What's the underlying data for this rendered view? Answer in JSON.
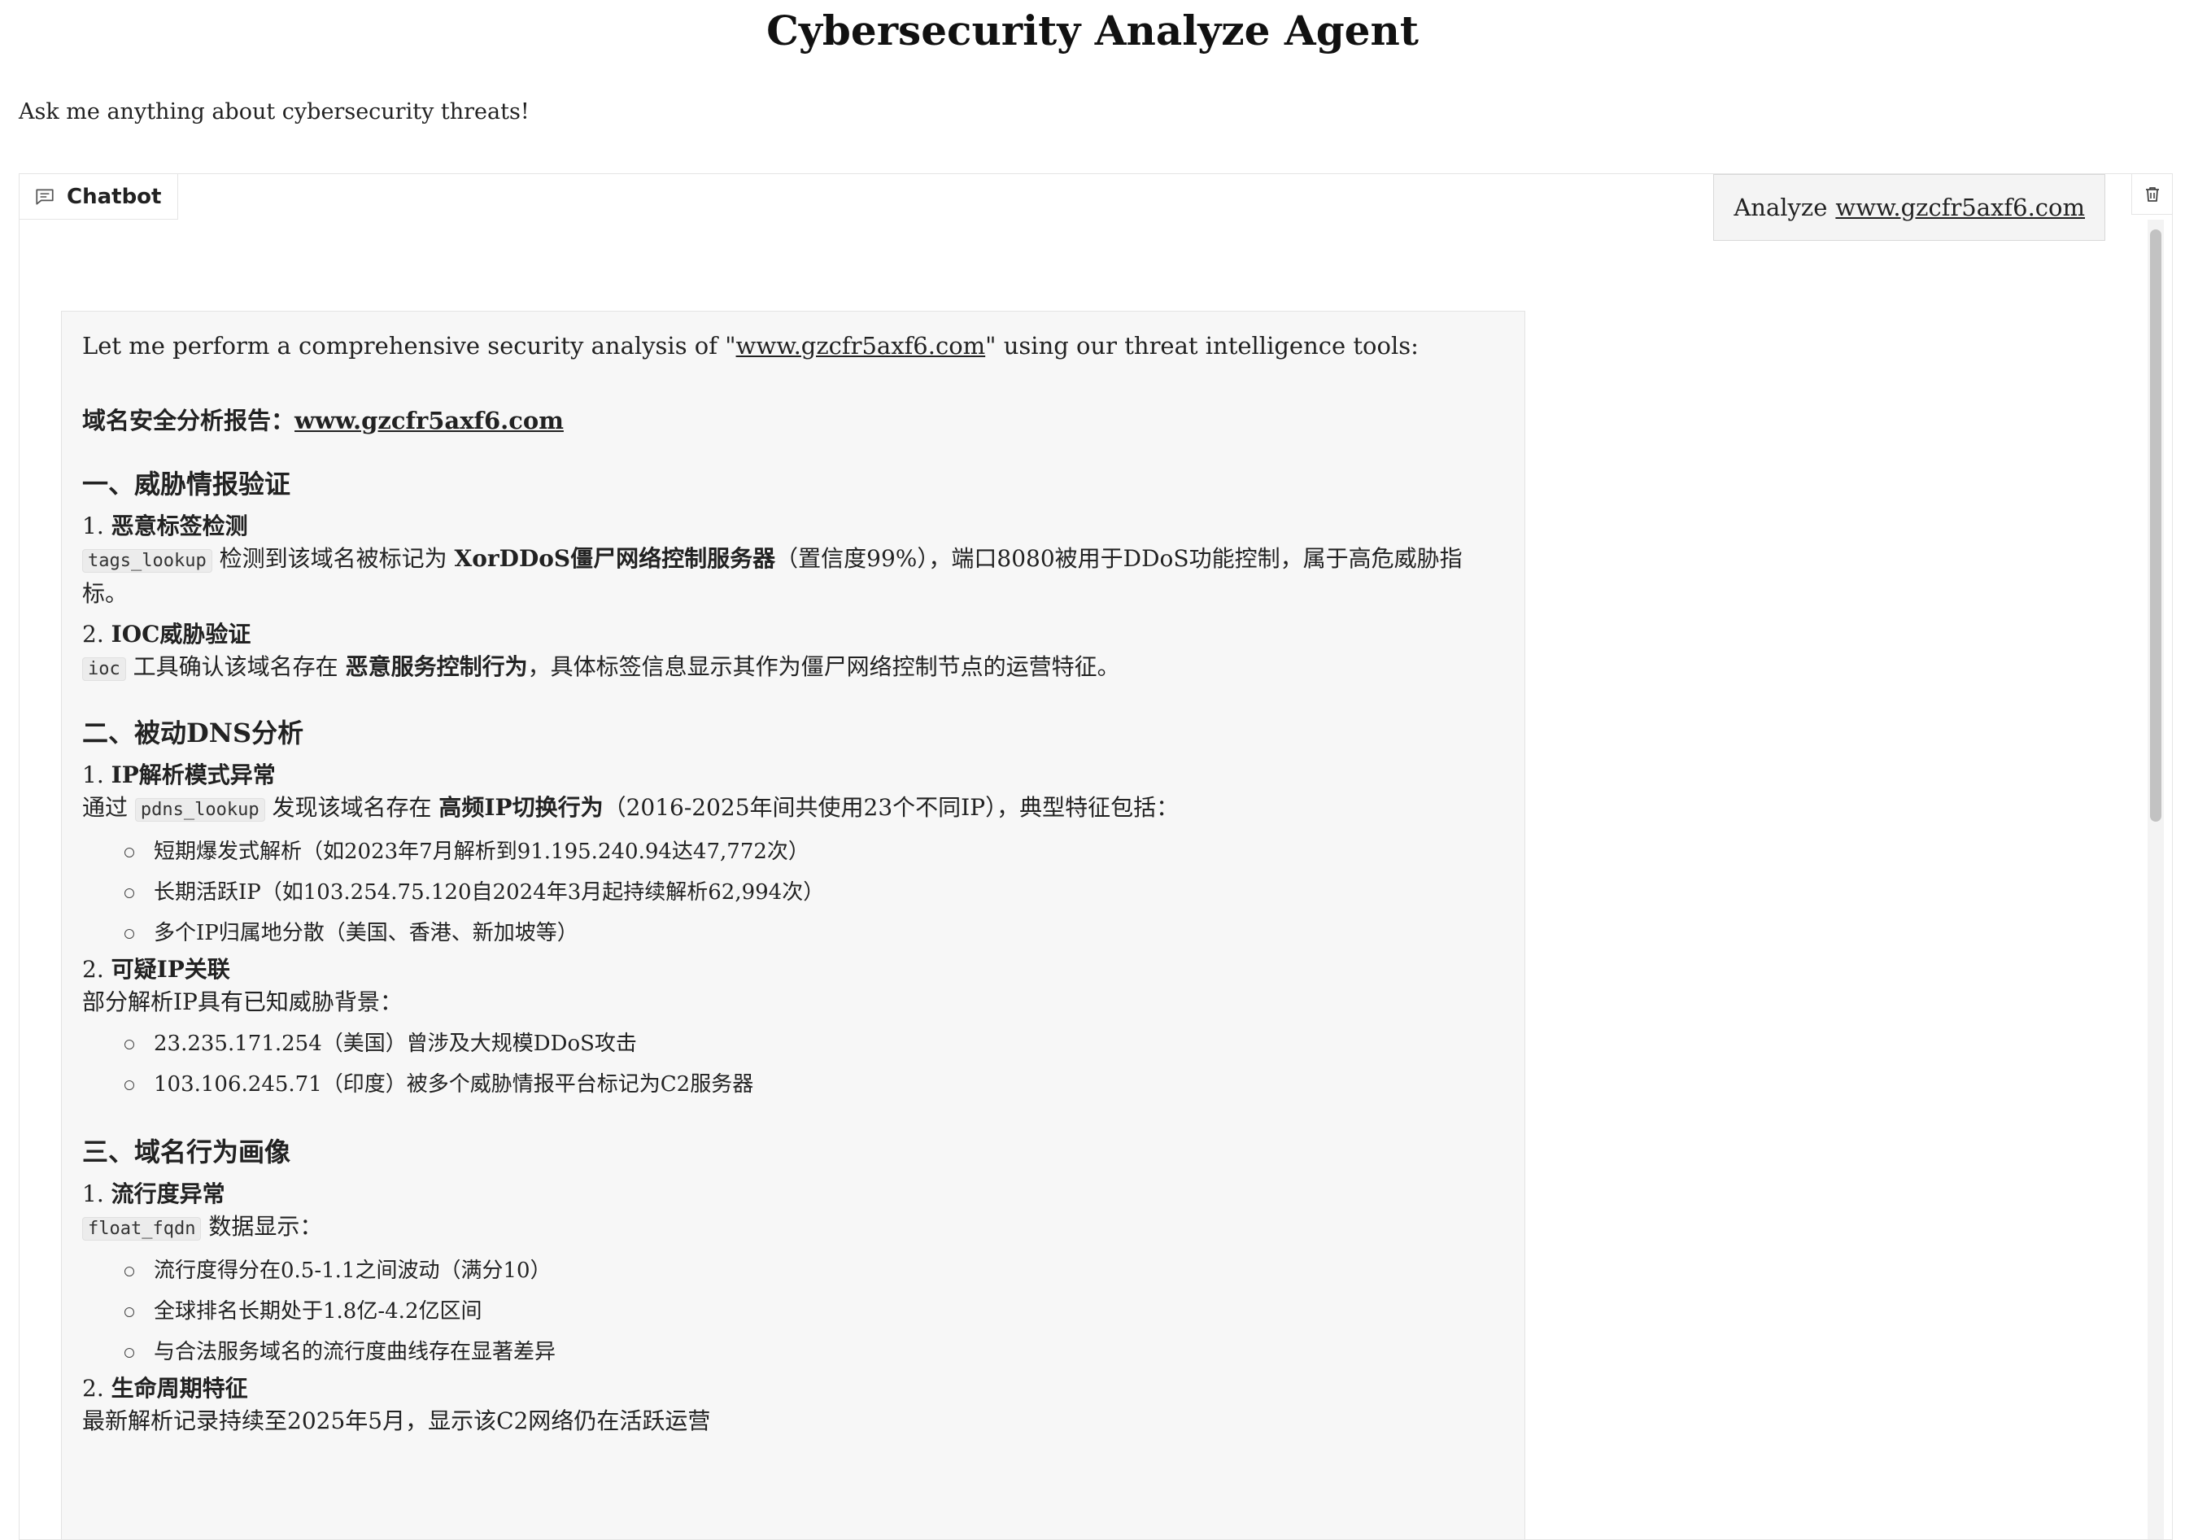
{
  "header": {
    "title": "Cybersecurity Analyze Agent",
    "subtitle": "Ask me anything about cybersecurity threats!"
  },
  "chatbot": {
    "label": "Chatbot",
    "user_message": {
      "prefix": "Analyze",
      "link": "www.gzcfr5axf6.com"
    },
    "bot_message": {
      "intro_pre": "Let me perform a comprehensive security analysis of \"",
      "intro_link": "www.gzcfr5axf6.com",
      "intro_post": "\" using our threat intelligence tools:",
      "report_title_pre": "域名安全分析报告：",
      "report_title_link": "www.gzcfr5axf6.com",
      "s1": {
        "heading": "一、威胁情报验证",
        "i1_num": "1.",
        "i1_title": "恶意标签检测",
        "i1_code": "tags_lookup",
        "i1_text_a": " 检测到该域名被标记为 ",
        "i1_bold": "XorDDoS僵尸网络控制服务器",
        "i1_text_b": "（置信度99%），端口8080被用于DDoS功能控制，属于高危威胁指标。",
        "i2_num": "2.",
        "i2_title": "IOC威胁验证",
        "i2_code": "ioc",
        "i2_text_a": " 工具确认该域名存在 ",
        "i2_bold": "恶意服务控制行为",
        "i2_text_b": "，具体标签信息显示其作为僵尸网络控制节点的运营特征。"
      },
      "s2": {
        "heading": "二、被动DNS分析",
        "i1_num": "1.",
        "i1_title": "IP解析模式异常",
        "i1_text_pre": "通过 ",
        "i1_code": "pdns_lookup",
        "i1_text_a": " 发现该域名存在 ",
        "i1_bold": "高频IP切换行为",
        "i1_text_b": "（2016-2025年间共使用23个不同IP），典型特征包括：",
        "i1_bullets": [
          "短期爆发式解析（如2023年7月解析到91.195.240.94达47,772次）",
          "长期活跃IP（如103.254.75.120自2024年3月起持续解析62,994次）",
          "多个IP归属地分散（美国、香港、新加坡等）"
        ],
        "i2_num": "2.",
        "i2_title": "可疑IP关联",
        "i2_text": "部分解析IP具有已知威胁背景：",
        "i2_bullets": [
          "23.235.171.254（美国）曾涉及大规模DDoS攻击",
          "103.106.245.71（印度）被多个威胁情报平台标记为C2服务器"
        ]
      },
      "s3": {
        "heading": "三、域名行为画像",
        "i1_num": "1.",
        "i1_title": "流行度异常",
        "i1_code": "float_fqdn",
        "i1_text": " 数据显示：",
        "i1_bullets": [
          "流行度得分在0.5-1.1之间波动（满分10）",
          "全球排名长期处于1.8亿-4.2亿区间",
          "与合法服务域名的流行度曲线存在显著差异"
        ],
        "i2_num": "2.",
        "i2_title": "生命周期特征",
        "i2_text": "最新解析记录持续至2025年5月，显示该C2网络仍在活跃运营"
      }
    }
  },
  "icons": {
    "chat": "chat-bubble-icon",
    "trash": "trash-icon"
  }
}
